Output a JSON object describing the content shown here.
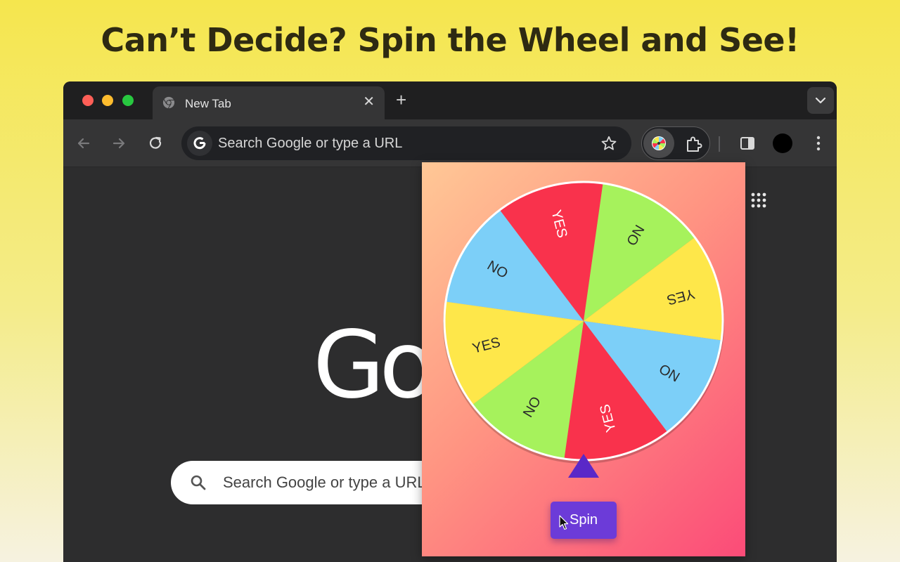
{
  "headline": "Can’t Decide? Spin the Wheel and See!",
  "browser": {
    "tab": {
      "title": "New Tab",
      "close_label": "✕"
    },
    "new_tab_label": "+",
    "omnibox": {
      "placeholder": "Search Google or type a URL"
    },
    "colors": {
      "frame": "#1f1f20",
      "toolbar": "#353536",
      "omnibox": "#202124",
      "content": "#2d2d2e"
    },
    "icons": [
      "back-arrow-icon",
      "forward-arrow-icon",
      "reload-icon",
      "google-g-icon",
      "bookmark-star-icon",
      "wheel-extension-icon",
      "extensions-puzzle-icon",
      "side-panel-icon",
      "profile-avatar",
      "menu-kebab-icon",
      "google-apps-icon",
      "search-icon"
    ]
  },
  "ntp": {
    "logo_text": "Go",
    "search_placeholder": "Search Google or type a URL"
  },
  "popup": {
    "segments": [
      {
        "label": "NO",
        "color": "#7ccff8"
      },
      {
        "label": "YES",
        "color": "#f9324c"
      },
      {
        "label": "NO",
        "color": "#a6f25c"
      },
      {
        "label": "YES",
        "color": "#fee74a"
      },
      {
        "label": "NO",
        "color": "#7ccff8"
      },
      {
        "label": "YES",
        "color": "#f9324c"
      },
      {
        "label": "NO",
        "color": "#a6f25c"
      },
      {
        "label": "YES",
        "color": "#fee74a"
      }
    ],
    "pointer_color": "#5a28c8",
    "spin_label": "Spin",
    "spin_color": "#6c3bd8",
    "background": [
      "#ffc896",
      "#ff9482",
      "#fb4b78"
    ]
  }
}
